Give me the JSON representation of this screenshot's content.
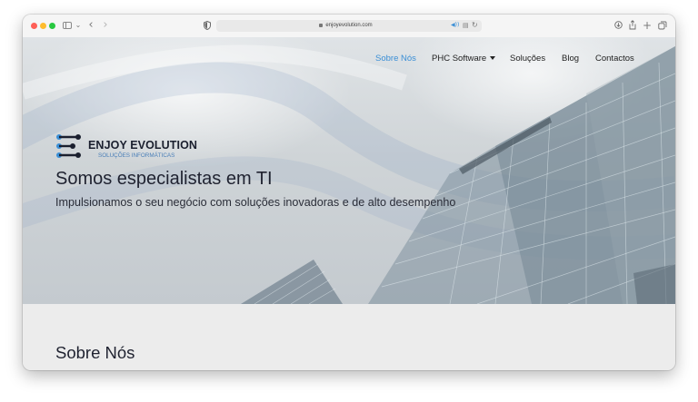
{
  "browser": {
    "url": "enjoyevolution.com",
    "icons": [
      "sidebar-icon",
      "chevron-down-icon",
      "back-icon",
      "forward-icon",
      "shield-icon",
      "lock-icon",
      "audio-icon",
      "reader-icon",
      "reload-icon",
      "download-icon",
      "share-icon",
      "new-tab-icon",
      "tabs-overview-icon"
    ],
    "glyphs": {
      "back": "‹",
      "forward": "›",
      "chevron": "⌄",
      "reload": "↻",
      "share": "⎙",
      "plus": "+",
      "download": "⊕",
      "audio": "◀))",
      "reader": "▤"
    }
  },
  "nav": {
    "items": [
      {
        "label": "Sobre Nós",
        "active": true
      },
      {
        "label": "PHC Software",
        "dropdown": true
      },
      {
        "label": "Soluções"
      },
      {
        "label": "Blog"
      },
      {
        "label": "Contactos"
      }
    ]
  },
  "hero": {
    "logo_name": "ENJOY EVOLUTION",
    "logo_subtitle": "SOLUÇÕES INFORMÁTICAS",
    "headline": "Somos especialistas em TI",
    "subheadline": "Impulsionamos o seu negócio com soluções inovadoras e de alto desempenho"
  },
  "section": {
    "title": "Sobre Nós"
  },
  "colors": {
    "accent": "#3b8fd6",
    "logo_dark": "#1a1f2e",
    "logo_blue": "#4a7fb8"
  }
}
